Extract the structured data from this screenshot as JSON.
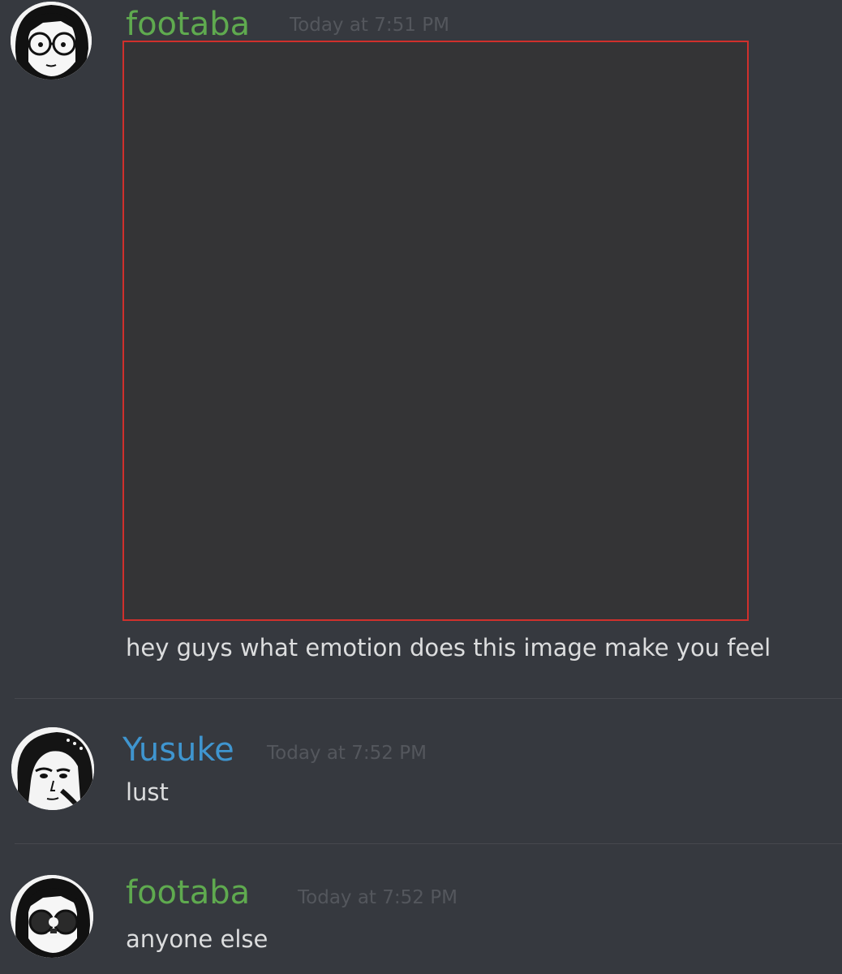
{
  "messages": [
    {
      "author": "footaba",
      "timestamp": "Today at 7:51 PM",
      "text": "hey guys what emotion does this image make you feel",
      "author_color": "#5faa4f",
      "avatar_icon": "glasses-girl-avatar-icon",
      "has_attachment": true
    },
    {
      "author": "Yusuke",
      "timestamp": "Today at 7:52 PM",
      "text": "lust",
      "author_color": "#3f95cf",
      "avatar_icon": "dark-haired-boy-avatar-icon"
    },
    {
      "author": "footaba",
      "timestamp": "Today at 7:52 PM",
      "text": "anyone else",
      "author_color": "#5faa4f",
      "avatar_icon": "glasses-girl-sad-avatar-icon"
    }
  ],
  "colors": {
    "background": "#36393f",
    "message_text": "#dcddde",
    "timestamp": "#54575d",
    "attachment_border": "#d0302c",
    "divider": "#46484e"
  }
}
